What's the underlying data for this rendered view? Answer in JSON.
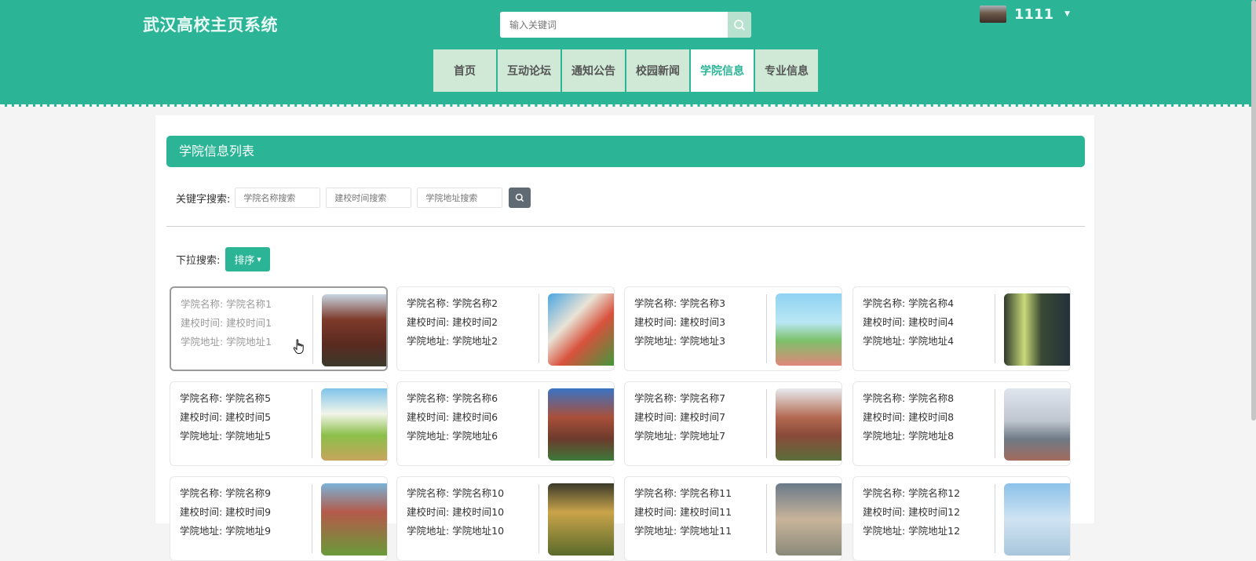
{
  "header": {
    "site_title": "武汉高校主页系统",
    "search_placeholder": "输入关键词",
    "username": "1111"
  },
  "nav": [
    {
      "label": "首页",
      "active": false
    },
    {
      "label": "互动论坛",
      "active": false
    },
    {
      "label": "通知公告",
      "active": false
    },
    {
      "label": "校园新闻",
      "active": false
    },
    {
      "label": "学院信息",
      "active": true
    },
    {
      "label": "专业信息",
      "active": false
    }
  ],
  "list": {
    "title": "学院信息列表",
    "keyword_label": "关键字搜索:",
    "filters": [
      {
        "placeholder": "学院名称搜索"
      },
      {
        "placeholder": "建校时间搜索"
      },
      {
        "placeholder": "学院地址搜索"
      }
    ],
    "dropdown_label": "下拉搜索:",
    "sort_label": "排序"
  },
  "cards": [
    {
      "name": "学院名称: 学院名称1",
      "time": "建校时间: 建校时间1",
      "addr": "学院地址: 学院地址1",
      "hover": true
    },
    {
      "name": "学院名称: 学院名称2",
      "time": "建校时间: 建校时间2",
      "addr": "学院地址: 学院地址2"
    },
    {
      "name": "学院名称: 学院名称3",
      "time": "建校时间: 建校时间3",
      "addr": "学院地址: 学院地址3"
    },
    {
      "name": "学院名称: 学院名称4",
      "time": "建校时间: 建校时间4",
      "addr": "学院地址: 学院地址4"
    },
    {
      "name": "学院名称: 学院名称5",
      "time": "建校时间: 建校时间5",
      "addr": "学院地址: 学院地址5"
    },
    {
      "name": "学院名称: 学院名称6",
      "time": "建校时间: 建校时间6",
      "addr": "学院地址: 学院地址6"
    },
    {
      "name": "学院名称: 学院名称7",
      "time": "建校时间: 建校时间7",
      "addr": "学院地址: 学院地址7"
    },
    {
      "name": "学院名称: 学院名称8",
      "time": "建校时间: 建校时间8",
      "addr": "学院地址: 学院地址8"
    },
    {
      "name": "学院名称: 学院名称9",
      "time": "建校时间: 建校时间9",
      "addr": "学院地址: 学院地址9"
    },
    {
      "name": "学院名称: 学院名称10",
      "time": "建校时间: 建校时间10",
      "addr": "学院地址: 学院地址10"
    },
    {
      "name": "学院名称: 学院名称11",
      "time": "建校时间: 建校时间11",
      "addr": "学院地址: 学院地址11"
    },
    {
      "name": "学院名称: 学院名称12",
      "time": "建校时间: 建校时间12",
      "addr": "学院地址: 学院地址12"
    }
  ],
  "theme": {
    "primary": "#2bb496",
    "nav_bg": "#cfe9d6",
    "search_btn": "#5f6a72"
  }
}
